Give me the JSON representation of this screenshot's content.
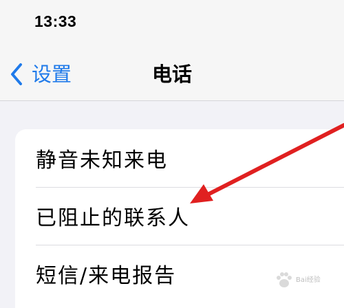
{
  "status_bar": {
    "time": "13:33"
  },
  "nav_bar": {
    "back_label": "设置",
    "title": "电话",
    "back_icon": "chevron-left-icon",
    "accent_color": "#1f7aea"
  },
  "settings": {
    "items": [
      {
        "label": "静音未知来电"
      },
      {
        "label": "已阻止的联系人"
      },
      {
        "label": "短信/来电报告"
      }
    ]
  },
  "annotation": {
    "arrow_color": "#e02020"
  },
  "watermark": {
    "icon": "paw-icon",
    "text": "Bai经验"
  }
}
